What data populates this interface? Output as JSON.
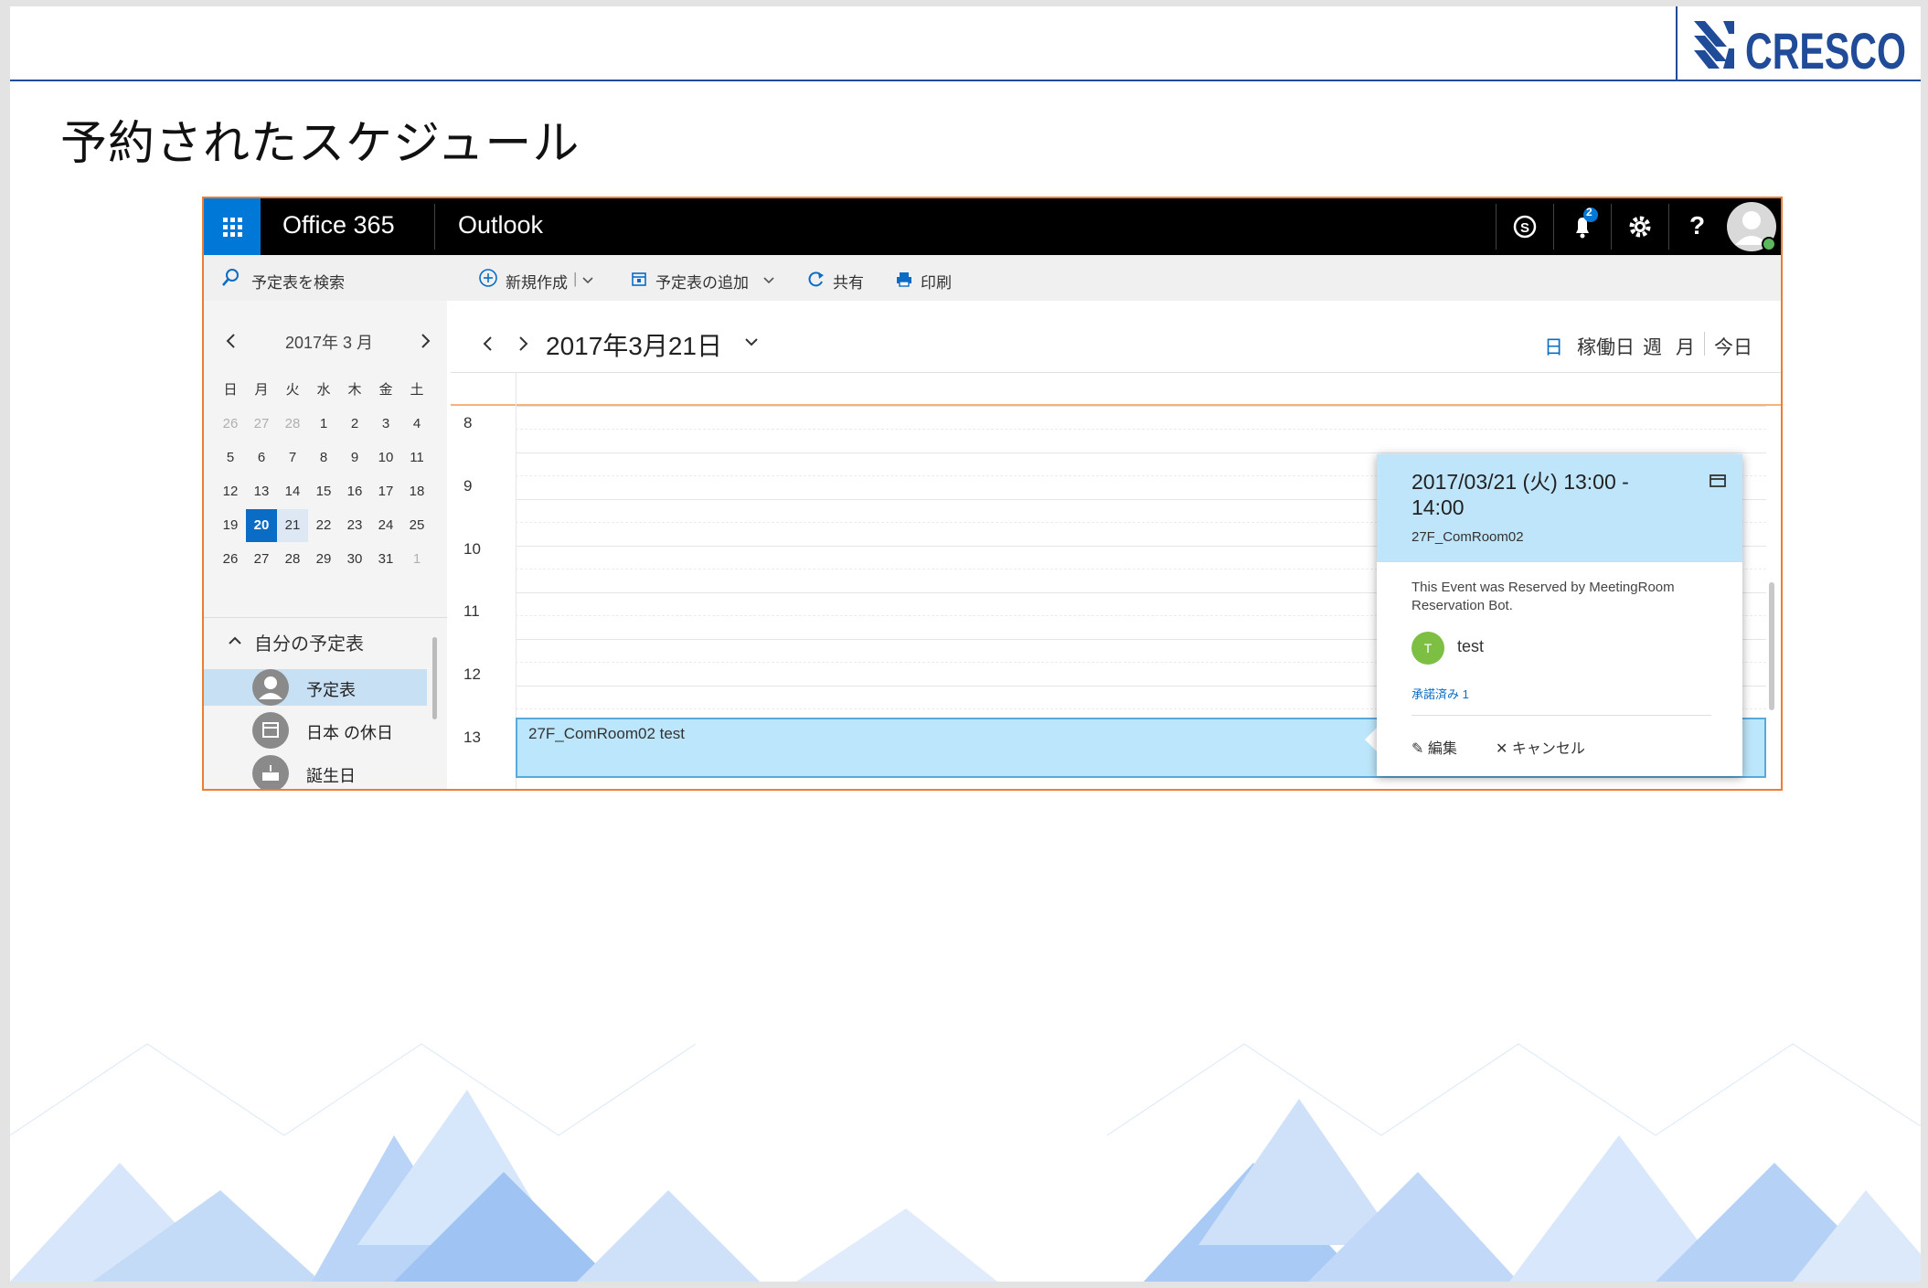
{
  "slide": {
    "title": "予約されたスケジュール",
    "logo_text": "CRESCO",
    "brand_color": "#1f4b99"
  },
  "o365": {
    "app_launcher_icon": "waffle-icon",
    "suite_name": "Office 365",
    "app_name": "Outlook",
    "notification_count": "2",
    "help_label": "?"
  },
  "toolbar": {
    "search_placeholder": "予定表を検索",
    "new_label": "新規作成",
    "add_calendar_label": "予定表の追加",
    "share_label": "共有",
    "print_label": "印刷"
  },
  "mini_calendar": {
    "title": "2017年 3 月",
    "weekdays": [
      "日",
      "月",
      "火",
      "水",
      "木",
      "金",
      "土"
    ],
    "weeks": [
      [
        "26",
        "27",
        "28",
        "1",
        "2",
        "3",
        "4"
      ],
      [
        "5",
        "6",
        "7",
        "8",
        "9",
        "10",
        "11"
      ],
      [
        "12",
        "13",
        "14",
        "15",
        "16",
        "17",
        "18"
      ],
      [
        "19",
        "20",
        "21",
        "22",
        "23",
        "24",
        "25"
      ],
      [
        "26",
        "27",
        "28",
        "29",
        "30",
        "31",
        "1"
      ]
    ],
    "selected_day": "20"
  },
  "my_calendars": {
    "header": "自分の予定表",
    "items": [
      {
        "label": "予定表",
        "icon": "person-icon"
      },
      {
        "label": "日本 の休日",
        "icon": "calendar-icon"
      },
      {
        "label": "誕生日",
        "icon": "cake-icon"
      }
    ]
  },
  "calendar_view": {
    "date_title": "2017年3月21日",
    "views": {
      "day": "日",
      "workweek": "稼働日",
      "week": "週",
      "month": "月",
      "today": "今日"
    },
    "hours": [
      "8",
      "9",
      "10",
      "11",
      "12",
      "13"
    ],
    "event_label": "27F_ComRoom02 test"
  },
  "event_popup": {
    "time": "2017/03/21 (火) 13:00 - 14:00",
    "room": "27F_ComRoom02",
    "description": "This Event was Reserved by MeetingRoom Reservation Bot.",
    "attendee_initial": "T",
    "attendee_name": "test",
    "accepted": "承諾済み 1",
    "edit_label": "編集",
    "cancel_label": "キャンセル"
  }
}
